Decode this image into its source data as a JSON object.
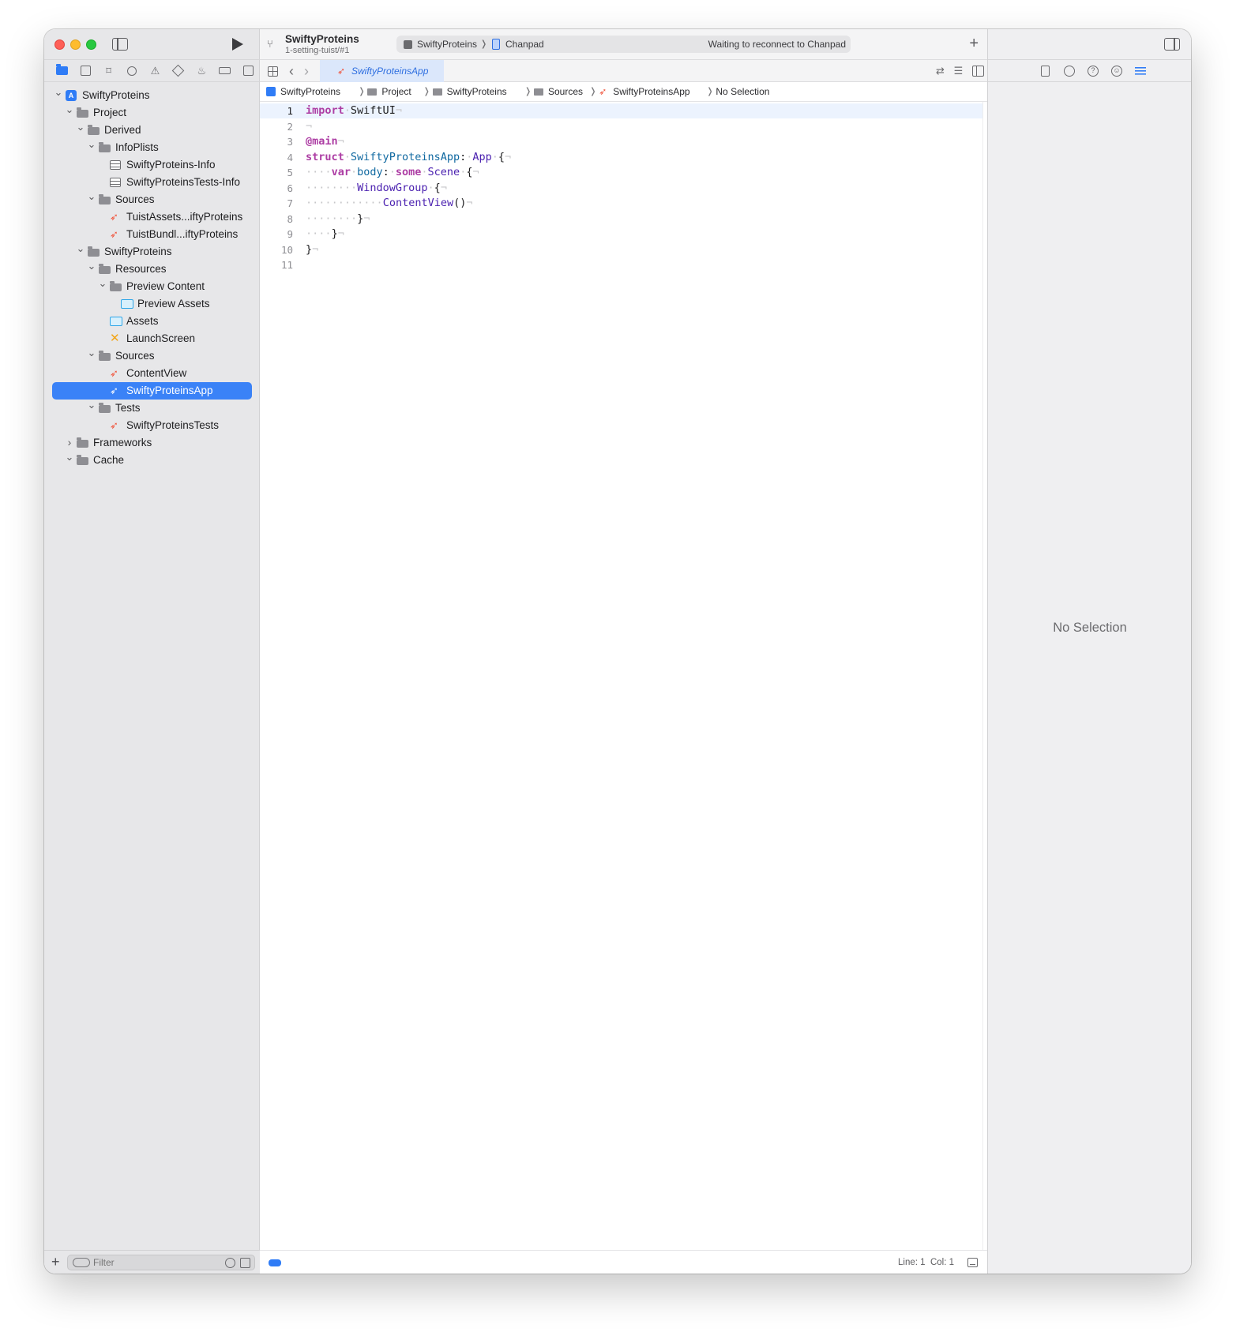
{
  "navigator": {
    "filter_placeholder": "Filter",
    "tree": [
      {
        "label": "SwiftyProteins",
        "icon": "project-icon",
        "depth": 0,
        "chevron": "open"
      },
      {
        "label": "Project",
        "icon": "folder-icon",
        "depth": 1,
        "chevron": "open"
      },
      {
        "label": "Derived",
        "icon": "folder-icon",
        "depth": 2,
        "chevron": "open"
      },
      {
        "label": "InfoPlists",
        "icon": "folder-icon",
        "depth": 3,
        "chevron": "open"
      },
      {
        "label": "SwiftyProteins-Info",
        "icon": "plist-icon",
        "depth": 4,
        "chevron": "none"
      },
      {
        "label": "SwiftyProteinsTests-Info",
        "icon": "plist-icon",
        "depth": 4,
        "chevron": "none"
      },
      {
        "label": "Sources",
        "icon": "folder-icon",
        "depth": 3,
        "chevron": "open"
      },
      {
        "label": "TuistAssets...iftyProteins",
        "icon": "swift-file-icon",
        "depth": 4,
        "chevron": "none"
      },
      {
        "label": "TuistBundl...iftyProteins",
        "icon": "swift-file-icon",
        "depth": 4,
        "chevron": "none"
      },
      {
        "label": "SwiftyProteins",
        "icon": "folder-icon",
        "depth": 2,
        "chevron": "open"
      },
      {
        "label": "Resources",
        "icon": "folder-icon",
        "depth": 3,
        "chevron": "open"
      },
      {
        "label": "Preview Content",
        "icon": "folder-icon",
        "depth": 4,
        "chevron": "open"
      },
      {
        "label": "Preview Assets",
        "icon": "asset-catalog-icon",
        "depth": 5,
        "chevron": "none"
      },
      {
        "label": "Assets",
        "icon": "asset-catalog-icon",
        "depth": 4,
        "chevron": "none"
      },
      {
        "label": "LaunchScreen",
        "icon": "storyboard-icon",
        "depth": 4,
        "chevron": "none"
      },
      {
        "label": "Sources",
        "icon": "folder-icon",
        "depth": 3,
        "chevron": "open"
      },
      {
        "label": "ContentView",
        "icon": "swift-file-icon",
        "depth": 4,
        "chevron": "none"
      },
      {
        "label": "SwiftyProteinsApp",
        "icon": "swift-file-icon",
        "depth": 4,
        "chevron": "none",
        "selected": true
      },
      {
        "label": "Tests",
        "icon": "folder-icon",
        "depth": 3,
        "chevron": "open"
      },
      {
        "label": "SwiftyProteinsTests",
        "icon": "swift-file-icon",
        "depth": 4,
        "chevron": "none"
      },
      {
        "label": "Frameworks",
        "icon": "folder-icon",
        "depth": 1,
        "chevron": "closed"
      },
      {
        "label": "Cache",
        "icon": "folder-icon",
        "depth": 1,
        "chevron": "open"
      }
    ]
  },
  "toolbar": {
    "project_name": "SwiftyProteins",
    "branch": "1-setting-tuist/#1",
    "scheme": "SwiftyProteins",
    "device": "Chanpad",
    "status": "Waiting to reconnect to Chanpad"
  },
  "tab": {
    "file_name": "SwiftyProteinsApp"
  },
  "jump_bar": {
    "items": [
      "SwiftyProteins",
      "Project",
      "SwiftyProteins",
      "Sources",
      "SwiftyProteinsApp",
      "No Selection"
    ]
  },
  "editor": {
    "current_line": 1,
    "lines": [
      "import SwiftUI",
      "",
      "@main",
      "struct SwiftyProteinsApp: App {",
      "    var body: some Scene {",
      "        WindowGroup {",
      "            ContentView()",
      "        }",
      "    }",
      "}",
      ""
    ],
    "cursor_line_label": "Line: 1",
    "cursor_col_label": "Col: 1"
  },
  "inspector": {
    "empty_label": "No Selection"
  },
  "colors": {
    "accent": "#3a82f7",
    "keyword": "#ad3da4",
    "type": "#4b21b0",
    "declaration": "#0f68a0",
    "swift": "#f05138"
  }
}
